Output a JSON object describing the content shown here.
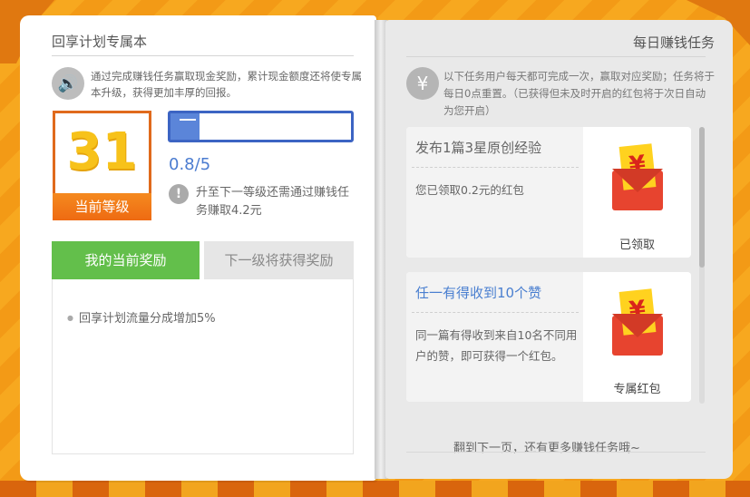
{
  "left": {
    "title": "回享计划专属本",
    "intro": "通过完成赚钱任务赢取现金奖励，累计现金额度还将使专属本升级，获得更加丰厚的回报。",
    "level": {
      "number": "31",
      "label": "当前等级"
    },
    "progress": {
      "text": "0.8/5",
      "fraction": 0.16
    },
    "upgrade_hint": "升至下一等级还需通过赚钱任务赚取4.2元",
    "tabs": [
      {
        "label": "我的当前奖励",
        "active": true
      },
      {
        "label": "下一级将获得奖励",
        "active": false
      }
    ],
    "rewards": [
      "回享计划流量分成增加5%"
    ]
  },
  "right": {
    "title": "每日赚钱任务",
    "intro": "以下任务用户每天都可完成一次，赢取对应奖励；任务将于每日0点重置。（已获得但未及时开启的红包将于次日自动为您开启）",
    "tasks": [
      {
        "title": "发布1篇3星原创经验",
        "title_color": "#666666",
        "description": "您已领取0.2元的红包",
        "status": "已领取"
      },
      {
        "title": "任一有得收到10个赞",
        "title_color": "#4a7fd0",
        "description": "同一篇有得收到来自10名不同用户的赞，即可获得一个红包。",
        "status": "专属红包"
      }
    ],
    "footer": "翻到下一页，还有更多赚钱任务哦~"
  },
  "icons": {
    "megaphone": "speaker-icon",
    "yen": "yen-icon",
    "warning": "exclamation-icon",
    "envelope": "red-envelope-icon"
  },
  "colors": {
    "accent_orange": "#ee6a12",
    "level_yellow": "#f7c21a",
    "progress_blue": "#3c64c3",
    "tab_green": "#63bf4b",
    "envelope_red": "#e7442f"
  }
}
